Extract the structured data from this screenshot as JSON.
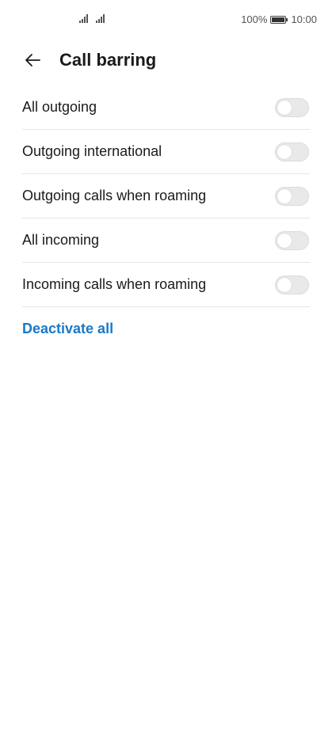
{
  "status_bar": {
    "battery_percent": "100%",
    "time": "10:00"
  },
  "header": {
    "title": "Call barring"
  },
  "options": [
    {
      "label": "All outgoing",
      "enabled": false
    },
    {
      "label": "Outgoing international",
      "enabled": false
    },
    {
      "label": "Outgoing calls when roaming",
      "enabled": false
    },
    {
      "label": "All incoming",
      "enabled": false
    },
    {
      "label": "Incoming calls when roaming",
      "enabled": false
    }
  ],
  "actions": {
    "deactivate_all": "Deactivate all"
  },
  "colors": {
    "accent": "#1979c7",
    "toggle_off": "#e9e9e9"
  }
}
